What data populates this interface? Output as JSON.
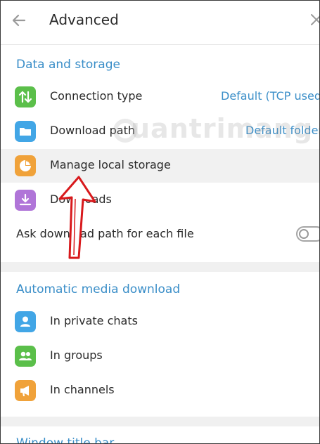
{
  "header": {
    "title": "Advanced",
    "back_icon": "arrow-left-icon",
    "close_icon": "close-icon"
  },
  "data_storage": {
    "section_title": "Data and storage",
    "items": [
      {
        "label": "Connection type",
        "value": "Default (TCP used)",
        "icon": "arrows-up-down-icon",
        "color": "#5bbf4a"
      },
      {
        "label": "Download path",
        "value": "Default folder",
        "icon": "folder-icon",
        "color": "#42a6e6"
      },
      {
        "label": "Manage local storage",
        "icon": "pie-chart-icon",
        "color": "#f0a23a"
      },
      {
        "label": "Downloads",
        "icon": "download-icon",
        "color": "#b075d8"
      }
    ],
    "ask_path": {
      "label": "Ask download path for each file",
      "enabled": false
    }
  },
  "auto_download": {
    "section_title": "Automatic media download",
    "items": [
      {
        "label": "In private chats",
        "icon": "user-icon",
        "color": "#42a6e6"
      },
      {
        "label": "In groups",
        "icon": "group-icon",
        "color": "#5bbf4a"
      },
      {
        "label": "In channels",
        "icon": "megaphone-icon",
        "color": "#f0a23a"
      }
    ]
  },
  "next_section_title": "Window title bar",
  "watermark": "uantrimang",
  "annotation": {
    "type": "arrow",
    "color": "#d8191c"
  }
}
